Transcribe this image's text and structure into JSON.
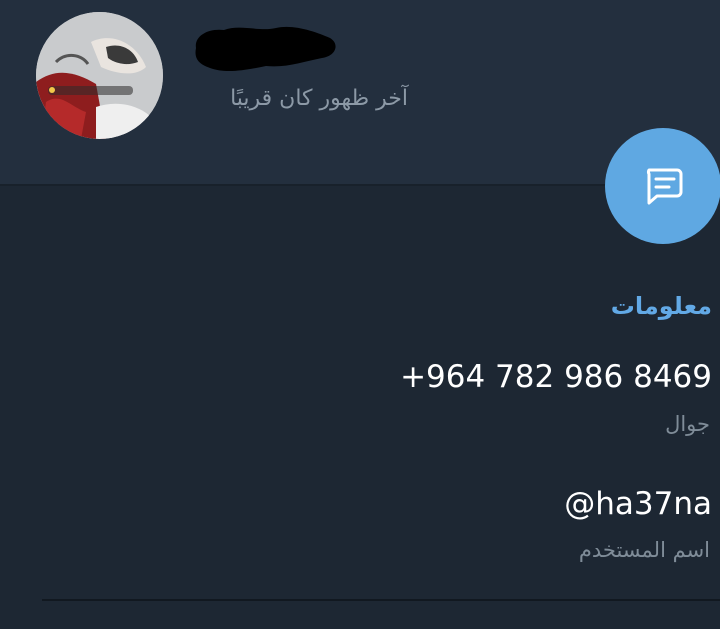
{
  "profile": {
    "last_seen": "آخر ظهور كان قريبًا"
  },
  "info": {
    "section_title": "معلومات",
    "phone": {
      "value": "+964 782 986 8469",
      "label": "جوال"
    },
    "username": {
      "value": "@ha37na",
      "label": "اسم المستخدم"
    }
  },
  "fab": {
    "icon": "message-icon"
  },
  "colors": {
    "background": "#1d2733",
    "header": "#232f3e",
    "accent": "#5fa8e2",
    "section_title": "#62a9e6",
    "secondary_text": "#7f8c98"
  }
}
